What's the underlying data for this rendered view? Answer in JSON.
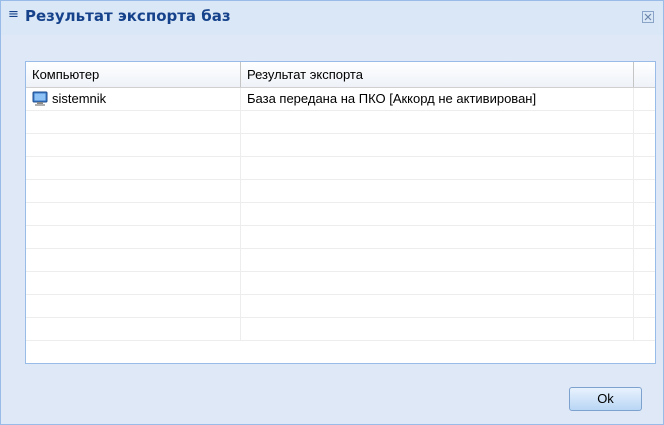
{
  "dialog": {
    "title": "Результат экспорта баз",
    "title_icon": "menu-lines-icon",
    "close_icon": "close-icon"
  },
  "grid": {
    "columns": [
      "Компьютер",
      "Результат экспорта",
      ""
    ],
    "rows": [
      {
        "computer": "sistemnik",
        "computer_icon": "computer-monitor-icon",
        "result": "База передана на ПКО [Аккорд не активирован]"
      }
    ],
    "empty_rows": 10
  },
  "buttons": {
    "ok_label": "Ok"
  },
  "colors": {
    "title": "#15428b",
    "background": "#dfe8f6",
    "border": "#99bbe8"
  }
}
